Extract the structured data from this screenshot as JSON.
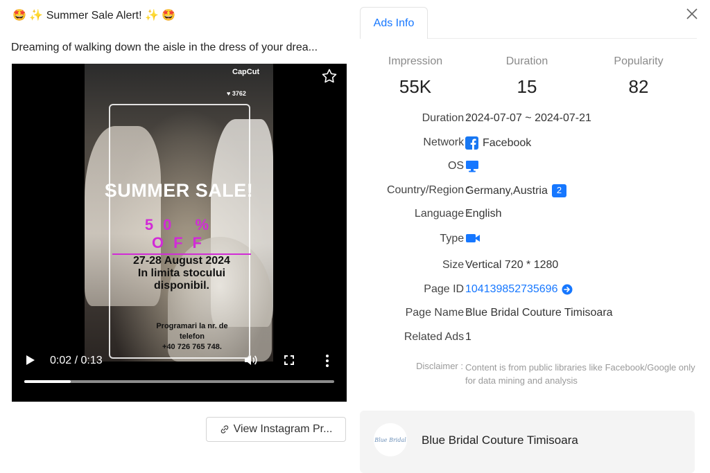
{
  "post": {
    "title": "🤩 ✨ Summer Sale Alert! ✨ 🤩",
    "description": "Dreaming of walking down the aisle in the dress of your drea..."
  },
  "video": {
    "watermark": "CapCut",
    "likes": "♥ 3762",
    "headline": "SUMMER SALE!",
    "discount": "50 % OFF",
    "dates_line1": "27-28 August 2024",
    "dates_line2": "In limita stocului",
    "dates_line3": "disponibil.",
    "phone_line1": "Programari la nr. de",
    "phone_line2": "telefon",
    "phone_line3": "+40 726 765 748.",
    "time_display": "0:02 / 0:13",
    "progress": 0.15
  },
  "view_button": {
    "label": "View Instagram Pr..."
  },
  "panel": {
    "tab_label": "Ads Info",
    "stats": [
      {
        "label": "Impression",
        "value": "55K"
      },
      {
        "label": "Duration",
        "value": "15"
      },
      {
        "label": "Popularity",
        "value": "82"
      }
    ],
    "rows": {
      "duration": {
        "label": "Duration :",
        "value": "2024-07-07 ~ 2024-07-21"
      },
      "network": {
        "label": "Network :",
        "value": "Facebook"
      },
      "os": {
        "label": "OS :"
      },
      "country": {
        "label": "Country/Region :",
        "value": "Germany,Austria",
        "badge": "2"
      },
      "language": {
        "label": "Language :",
        "value": "English"
      },
      "type": {
        "label": "Type :"
      },
      "size": {
        "label": "Size :",
        "value": "Vertical 720 * 1280"
      },
      "page_id": {
        "label": "Page ID :",
        "value": "104139852735696"
      },
      "page_name": {
        "label": "Page Name :",
        "value": "Blue Bridal Couture Timisoara"
      },
      "related": {
        "label": "Related Ads :",
        "value": "1"
      }
    },
    "disclaimer": {
      "label": "Disclaimer :",
      "text": "Content is from public libraries like Facebook/Google only for data mining and analysis"
    },
    "page_card": {
      "name": "Blue Bridal Couture Timisoara",
      "logo_text": "Blue Bridal"
    }
  },
  "colors": {
    "accent": "#1677ff",
    "magenta": "#d12bd6"
  },
  "icons": [
    "star-icon",
    "play-icon",
    "volume-icon",
    "fullscreen-icon",
    "more-vertical-icon",
    "link-icon",
    "close-icon",
    "facebook-icon",
    "desktop-icon",
    "video-camera-icon",
    "arrow-right-circle-icon"
  ]
}
